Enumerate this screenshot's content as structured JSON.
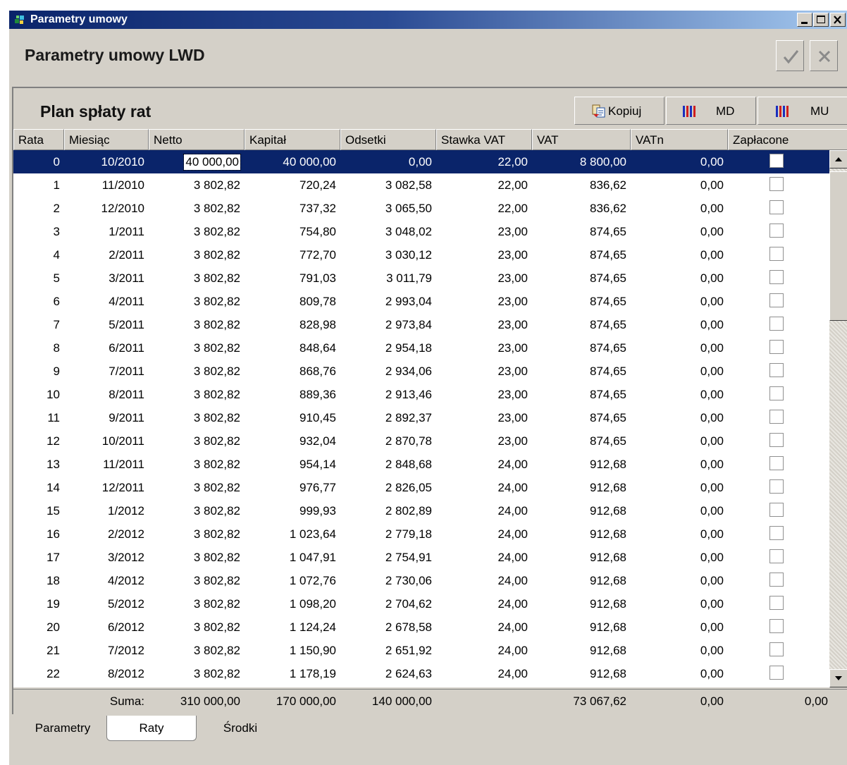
{
  "window": {
    "title": "Parametry umowy",
    "icon": "app-icon"
  },
  "header": {
    "title": "Parametry umowy LWD",
    "ok_icon": "checkmark-icon",
    "cancel_icon": "close-icon"
  },
  "panel": {
    "title": "Plan spłaty rat",
    "buttons": {
      "kopiuj": "Kopiuj",
      "md": "MD",
      "mu": "MU"
    }
  },
  "columns": [
    "Rata",
    "Miesiąc",
    "Netto",
    "Kapitał",
    "Odsetki",
    "Stawka VAT",
    "VAT",
    "VATn",
    "Zapłacone"
  ],
  "rows": [
    {
      "rata": "0",
      "miesiac": "10/2010",
      "netto": "40 000,00",
      "kapital": "40 000,00",
      "odsetki": "0,00",
      "stawka": "22,00",
      "vat": "8 800,00",
      "vatn": "0,00",
      "zaplacone": false
    },
    {
      "rata": "1",
      "miesiac": "11/2010",
      "netto": "3 802,82",
      "kapital": "720,24",
      "odsetki": "3 082,58",
      "stawka": "22,00",
      "vat": "836,62",
      "vatn": "0,00",
      "zaplacone": false
    },
    {
      "rata": "2",
      "miesiac": "12/2010",
      "netto": "3 802,82",
      "kapital": "737,32",
      "odsetki": "3 065,50",
      "stawka": "22,00",
      "vat": "836,62",
      "vatn": "0,00",
      "zaplacone": false
    },
    {
      "rata": "3",
      "miesiac": "1/2011",
      "netto": "3 802,82",
      "kapital": "754,80",
      "odsetki": "3 048,02",
      "stawka": "23,00",
      "vat": "874,65",
      "vatn": "0,00",
      "zaplacone": false
    },
    {
      "rata": "4",
      "miesiac": "2/2011",
      "netto": "3 802,82",
      "kapital": "772,70",
      "odsetki": "3 030,12",
      "stawka": "23,00",
      "vat": "874,65",
      "vatn": "0,00",
      "zaplacone": false
    },
    {
      "rata": "5",
      "miesiac": "3/2011",
      "netto": "3 802,82",
      "kapital": "791,03",
      "odsetki": "3 011,79",
      "stawka": "23,00",
      "vat": "874,65",
      "vatn": "0,00",
      "zaplacone": false
    },
    {
      "rata": "6",
      "miesiac": "4/2011",
      "netto": "3 802,82",
      "kapital": "809,78",
      "odsetki": "2 993,04",
      "stawka": "23,00",
      "vat": "874,65",
      "vatn": "0,00",
      "zaplacone": false
    },
    {
      "rata": "7",
      "miesiac": "5/2011",
      "netto": "3 802,82",
      "kapital": "828,98",
      "odsetki": "2 973,84",
      "stawka": "23,00",
      "vat": "874,65",
      "vatn": "0,00",
      "zaplacone": false
    },
    {
      "rata": "8",
      "miesiac": "6/2011",
      "netto": "3 802,82",
      "kapital": "848,64",
      "odsetki": "2 954,18",
      "stawka": "23,00",
      "vat": "874,65",
      "vatn": "0,00",
      "zaplacone": false
    },
    {
      "rata": "9",
      "miesiac": "7/2011",
      "netto": "3 802,82",
      "kapital": "868,76",
      "odsetki": "2 934,06",
      "stawka": "23,00",
      "vat": "874,65",
      "vatn": "0,00",
      "zaplacone": false
    },
    {
      "rata": "10",
      "miesiac": "8/2011",
      "netto": "3 802,82",
      "kapital": "889,36",
      "odsetki": "2 913,46",
      "stawka": "23,00",
      "vat": "874,65",
      "vatn": "0,00",
      "zaplacone": false
    },
    {
      "rata": "11",
      "miesiac": "9/2011",
      "netto": "3 802,82",
      "kapital": "910,45",
      "odsetki": "2 892,37",
      "stawka": "23,00",
      "vat": "874,65",
      "vatn": "0,00",
      "zaplacone": false
    },
    {
      "rata": "12",
      "miesiac": "10/2011",
      "netto": "3 802,82",
      "kapital": "932,04",
      "odsetki": "2 870,78",
      "stawka": "23,00",
      "vat": "874,65",
      "vatn": "0,00",
      "zaplacone": false
    },
    {
      "rata": "13",
      "miesiac": "11/2011",
      "netto": "3 802,82",
      "kapital": "954,14",
      "odsetki": "2 848,68",
      "stawka": "24,00",
      "vat": "912,68",
      "vatn": "0,00",
      "zaplacone": false
    },
    {
      "rata": "14",
      "miesiac": "12/2011",
      "netto": "3 802,82",
      "kapital": "976,77",
      "odsetki": "2 826,05",
      "stawka": "24,00",
      "vat": "912,68",
      "vatn": "0,00",
      "zaplacone": false
    },
    {
      "rata": "15",
      "miesiac": "1/2012",
      "netto": "3 802,82",
      "kapital": "999,93",
      "odsetki": "2 802,89",
      "stawka": "24,00",
      "vat": "912,68",
      "vatn": "0,00",
      "zaplacone": false
    },
    {
      "rata": "16",
      "miesiac": "2/2012",
      "netto": "3 802,82",
      "kapital": "1 023,64",
      "odsetki": "2 779,18",
      "stawka": "24,00",
      "vat": "912,68",
      "vatn": "0,00",
      "zaplacone": false
    },
    {
      "rata": "17",
      "miesiac": "3/2012",
      "netto": "3 802,82",
      "kapital": "1 047,91",
      "odsetki": "2 754,91",
      "stawka": "24,00",
      "vat": "912,68",
      "vatn": "0,00",
      "zaplacone": false
    },
    {
      "rata": "18",
      "miesiac": "4/2012",
      "netto": "3 802,82",
      "kapital": "1 072,76",
      "odsetki": "2 730,06",
      "stawka": "24,00",
      "vat": "912,68",
      "vatn": "0,00",
      "zaplacone": false
    },
    {
      "rata": "19",
      "miesiac": "5/2012",
      "netto": "3 802,82",
      "kapital": "1 098,20",
      "odsetki": "2 704,62",
      "stawka": "24,00",
      "vat": "912,68",
      "vatn": "0,00",
      "zaplacone": false
    },
    {
      "rata": "20",
      "miesiac": "6/2012",
      "netto": "3 802,82",
      "kapital": "1 124,24",
      "odsetki": "2 678,58",
      "stawka": "24,00",
      "vat": "912,68",
      "vatn": "0,00",
      "zaplacone": false
    },
    {
      "rata": "21",
      "miesiac": "7/2012",
      "netto": "3 802,82",
      "kapital": "1 150,90",
      "odsetki": "2 651,92",
      "stawka": "24,00",
      "vat": "912,68",
      "vatn": "0,00",
      "zaplacone": false
    },
    {
      "rata": "22",
      "miesiac": "8/2012",
      "netto": "3 802,82",
      "kapital": "1 178,19",
      "odsetki": "2 624,63",
      "stawka": "24,00",
      "vat": "912,68",
      "vatn": "0,00",
      "zaplacone": false
    }
  ],
  "selected_row": 0,
  "totals": {
    "label": "Suma:",
    "netto": "310 000,00",
    "kapital": "170 000,00",
    "odsetki": "140 000,00",
    "vat": "73 067,62",
    "vatn": "0,00",
    "zaplacone": "0,00"
  },
  "tabs": [
    {
      "label": "Parametry",
      "active": false
    },
    {
      "label": "Raty",
      "active": true
    },
    {
      "label": "Środki",
      "active": false
    }
  ],
  "colors": {
    "title_bar_start": "#0a246a",
    "title_bar_end": "#a6caf0",
    "selection": "#0a246a",
    "face": "#d4d0c8"
  }
}
